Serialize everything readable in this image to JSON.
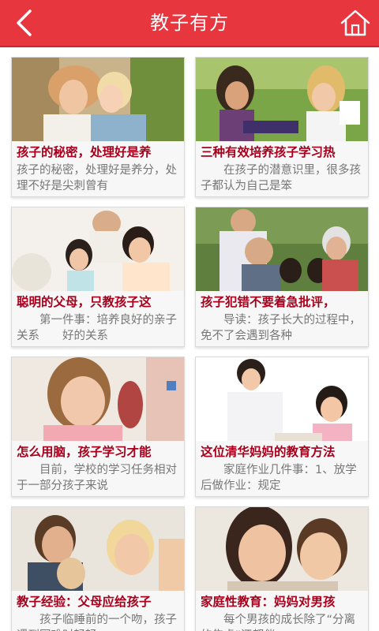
{
  "header": {
    "title": "教子有方",
    "back_icon": "back-chevron-icon",
    "home_icon": "home-icon",
    "bg_color": "#e8363f"
  },
  "articles": [
    {
      "title": "孩子的秘密，处理好是养",
      "summary": "孩子的秘密，处理好是养分，处理不好是尖刺曾有",
      "image": "mother-and-child-photo"
    },
    {
      "title": "三种有效培养孩子学习热",
      "summary": "　　在孩子的潜意识里，很多孩子都认为自己是笨",
      "image": "two-girls-lying-on-grass-photo"
    },
    {
      "title": "聪明的父母，只教孩子这",
      "summary": "　　第一件事：培养良好的亲子关系　　好的关系",
      "image": "family-reading-photo"
    },
    {
      "title": "孩子犯错不要着急批评，",
      "summary": "　　导读：孩子长大的过程中，免不了会遇到各种",
      "image": "grandparents-and-children-photo"
    },
    {
      "title": "怎么用脑，孩子学习才能",
      "summary": "　　目前，学校的学习任务相对于一部分孩子来说",
      "image": "girl-studying-photo"
    },
    {
      "title": "这位清华妈妈的教育方法",
      "summary": "　　家庭作业几件事：1、放学后做作业：规定",
      "image": "mother-and-daughter-writing-photo"
    },
    {
      "title": "教子经验：父母应给孩子",
      "summary": "　　孩子临睡前的一个吻，孩子遇到困难时轻轻",
      "image": "happy-family-photo"
    },
    {
      "title": "家庭性教育：妈妈对男孩",
      "summary": "　　每个男孩的成长除了“分离的焦虑”还都伴",
      "image": "mother-and-son-photo"
    }
  ],
  "colors": {
    "accent": "#e8363f",
    "card_title": "#a8001c",
    "card_text": "#777777"
  }
}
